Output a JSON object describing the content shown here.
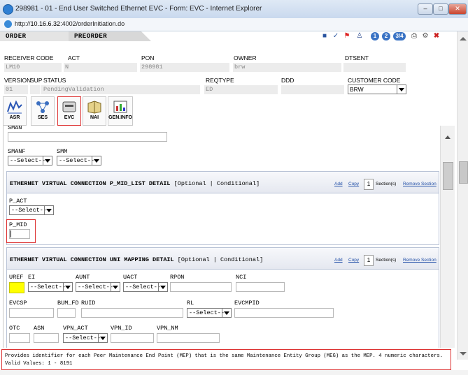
{
  "window": {
    "title": "298981 - 01 - End User Switched Ethernet EVC - Form: EVC - Internet Explorer"
  },
  "address": {
    "url_prefix": "http://",
    "url_host": "10.16.6.32",
    "url_rest": ":4002/orderInitiation.do"
  },
  "tabs": {
    "order": "ORDER",
    "preorder": "PREORDER"
  },
  "toolbar": {
    "icons": [
      "save-icon",
      "check-icon",
      "flag-icon",
      "person-icon",
      "page-1-icon",
      "page-2-icon",
      "page-3-4-icon",
      "print-icon",
      "settings-icon",
      "close-icon"
    ],
    "page1": "1",
    "page2": "2",
    "page34": "3/4"
  },
  "header": {
    "receiver_code_label": "RECEIVER CODE",
    "receiver_code": "LM10",
    "act_label": "ACT",
    "act": "N",
    "pon_label": "PON",
    "pon": "298981",
    "owner_label": "OWNER",
    "owner": "brw",
    "dtsent_label": "DTSENT",
    "dtsent": "",
    "version_label": "VERSION",
    "version": "01",
    "sup_label": "SUP",
    "sup": "",
    "status_label": "STATUS",
    "status": "PendingValidation",
    "reqtype_label": "REQTYPE",
    "reqtype": "ED",
    "ddd_label": "DDD",
    "ddd": "",
    "customer_code_label": "CUSTOMER CODE",
    "customer_code": "BRW"
  },
  "forms": [
    {
      "label": "ASR",
      "icon": "asr-icon"
    },
    {
      "label": "SES",
      "icon": "ses-icon"
    },
    {
      "label": "EVC",
      "icon": "evc-icon",
      "active": true
    },
    {
      "label": "NAI",
      "icon": "nai-icon"
    },
    {
      "label": "GEN.INFO",
      "icon": "gen-info-icon"
    }
  ],
  "form": {
    "sman_label": "SMAN",
    "smanf_label": "SMANF",
    "smanf": "--Select--",
    "smm_label": "SMM",
    "smm": "--Select--",
    "p_mid_section": {
      "title": "ETHERNET VIRTUAL CONNECTION P_MID_LIST DETAIL",
      "qualifier": "[Optional | Conditional]",
      "add": "Add",
      "copy": "Copy",
      "count": "1",
      "sections": "Section(s)",
      "remove": "Remove Section",
      "p_act_label": "P_ACT",
      "p_act": "--Select--",
      "p_mid_label": "P_MID"
    },
    "uni_section": {
      "title": "ETHERNET VIRTUAL CONNECTION UNI MAPPING DETAIL",
      "qualifier": "[Optional | Conditional]",
      "add": "Add",
      "copy": "Copy",
      "count": "1",
      "sections": "Section(s)",
      "remove": "Remove Section",
      "uref_label": "UREF",
      "ei_label": "EI",
      "ei": "--Select--",
      "aunt_label": "AUNT",
      "aunt": "--Select--",
      "uact_label": "UACT",
      "uact": "--Select--",
      "rpon_label": "RPON",
      "nci_label": "NCI",
      "evcsp_label": "EVCSP",
      "bum_fd_label": "BUM_FD",
      "ruid_label": "RUID",
      "rl_label": "RL",
      "rl": "--Select--",
      "evcmpid_label": "EVCMPID",
      "otc_label": "OTC",
      "asn_label": "ASN",
      "vpn_act_label": "VPN_ACT",
      "vpn_act": "--Select--",
      "vpn_id_label": "VPN_ID",
      "vpn_nm_label": "VPN_NM"
    }
  },
  "help": {
    "text": "Provides identifier for each Peer Maintenance End Point (MEP) that is the same Maintenance Entity Group (MEG) as the MEP. 4 numeric characters. Valid Values: 1 - 8191"
  }
}
